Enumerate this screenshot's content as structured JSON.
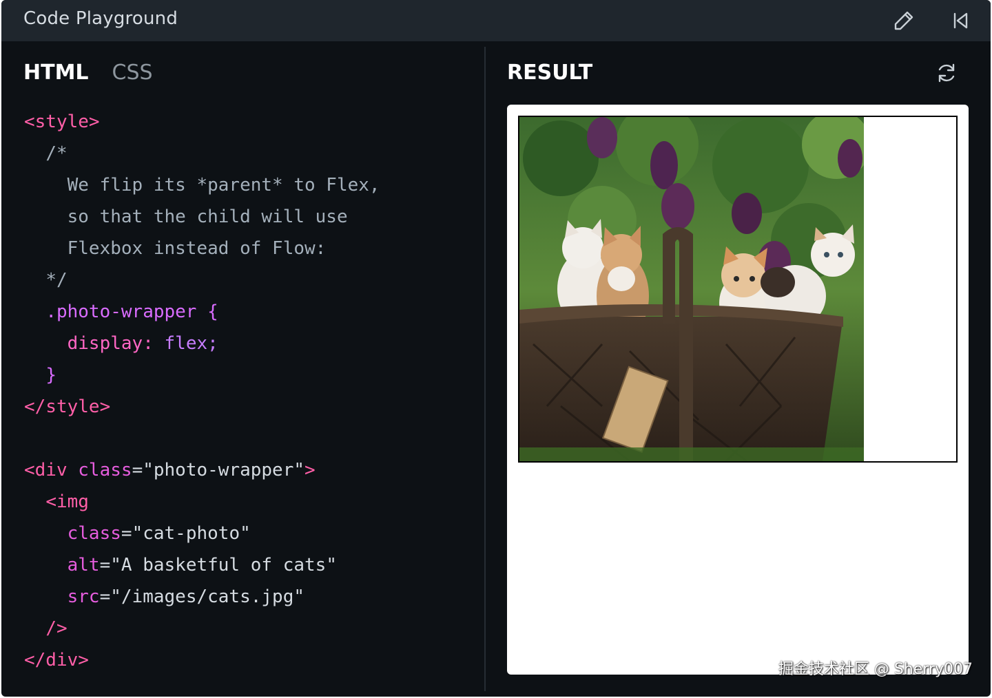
{
  "window": {
    "title": "Code Playground"
  },
  "editor": {
    "tabs": [
      {
        "label": "HTML",
        "active": true
      },
      {
        "label": "CSS",
        "active": false
      }
    ],
    "code": {
      "l1": "<style>",
      "l2": "/*",
      "l3": "We flip its *parent* to Flex,",
      "l4": "so that the child will use",
      "l5": "Flexbox instead of Flow:",
      "l6": "*/",
      "l7_sel": ".photo-wrapper",
      "l7_brace": "{",
      "l8_prop": "display:",
      "l8_val": "flex;",
      "l9": "}",
      "l10": "</style>",
      "l12_open": "<div",
      "l12_attr": "class",
      "l12_eq": "=",
      "l12_str": "\"photo-wrapper\"",
      "l12_close": ">",
      "l13": "<img",
      "l14_attr": "class",
      "l14_eq": "=",
      "l14_str": "\"cat-photo\"",
      "l15_attr": "alt",
      "l15_eq": "=",
      "l15_str": "\"A basketful of cats\"",
      "l16_attr": "src",
      "l16_eq": "=",
      "l16_str": "\"/images/cats.jpg\"",
      "l17": "/>",
      "l18": "</div>"
    }
  },
  "result": {
    "label": "RESULT",
    "image_alt": "A basketful of cats"
  },
  "watermark": "掘金技术社区 @ Sherry007",
  "icons": {
    "edit": "pencil-icon",
    "reset": "skip-back-icon",
    "refresh": "refresh-icon"
  },
  "colors": {
    "background": "#0d1115",
    "titlebar": "#1f262d",
    "tag": "#ff5fa8",
    "attribute": "#e65dde",
    "comment": "#a4b0bb"
  }
}
